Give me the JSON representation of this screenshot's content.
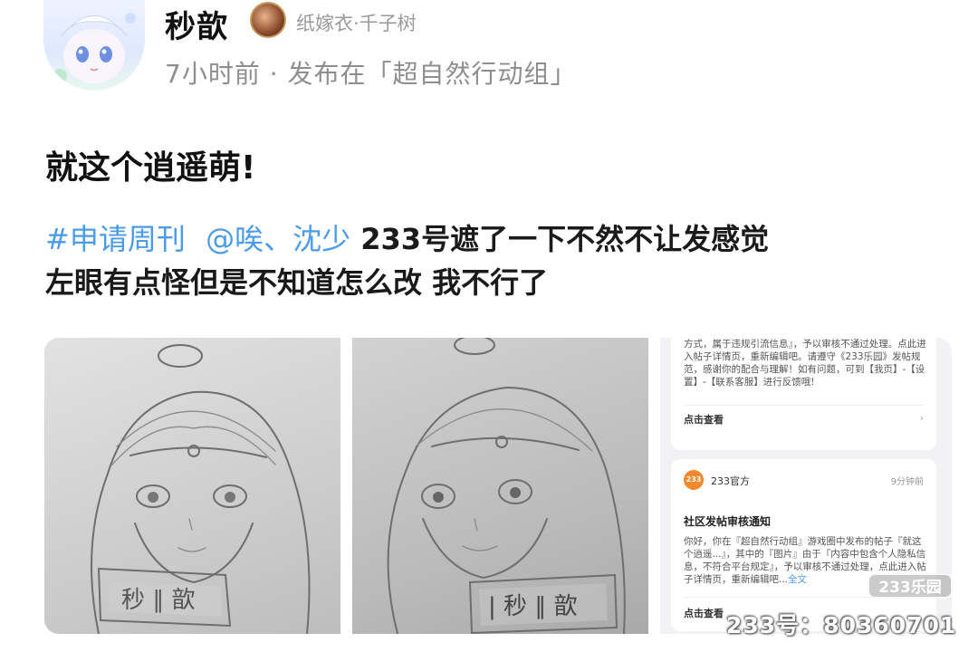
{
  "user": {
    "name": "秒歆",
    "title_badge": "纸嫁衣·千子树",
    "meta": "7小时前 · 发布在「超自然行动组」"
  },
  "post": {
    "title": "就这个逍遥萌!",
    "topic": "#申请周刊",
    "mention": "@唉、沈少",
    "body_line1": "233号遮了一下不然不让发感觉",
    "body_line2": "左眼有点怪但是不知道怎么改 我不行了"
  },
  "screenshot": {
    "card1_text": "方式，属于违规引流信息』，予以审核不通过处理。点此进入帖子详情页，重新编辑吧。请遵守《233乐园》发帖规范，感谢你的配合与理解！如有问题，可到【我页】-【设置】-【联系客服】进行反馈哦!",
    "card1_link": "点击查看",
    "badge": "233",
    "official_name": "233官方",
    "time": "9分钟前",
    "notice_title": "社区发帖审核通知",
    "notice_body": "你好，你在『超自然行动组』游戏圈中发布的帖子『就这个逍遥...』，其中的『图片』由于『内容中包含个人隐私信息，不符合平台规定』，予以审核不通过处理，点此进入帖子详情页，重新编辑吧...",
    "full_text": "全文",
    "card2_link": "点击查看",
    "chevron": "›"
  },
  "watermark": {
    "logo": "233乐园",
    "id": "233号：80360701"
  },
  "icons": [
    "avatar",
    "title-badge-icon",
    "chevron-right-icon"
  ]
}
